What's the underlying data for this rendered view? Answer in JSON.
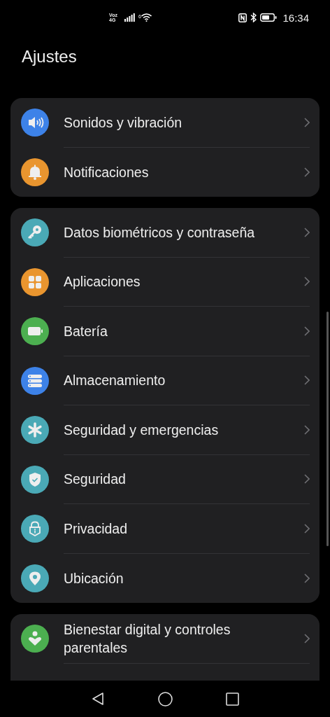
{
  "status_bar": {
    "network_top": "Voz",
    "network_bottom": "4G",
    "wifi_badge": "6",
    "time": "16:34"
  },
  "title": "Ajustes",
  "groups": [
    {
      "items": [
        {
          "label": "Sonidos y vibración",
          "kind": "speaker",
          "color": "#3d82e8"
        },
        {
          "label": "Notificaciones",
          "kind": "bell",
          "color": "#e9952f"
        }
      ]
    },
    {
      "items": [
        {
          "label": "Datos biométricos y contraseña",
          "kind": "key",
          "color": "#4aa9b6"
        },
        {
          "label": "Aplicaciones",
          "kind": "grid",
          "color": "#e9952f"
        },
        {
          "label": "Batería",
          "kind": "battery",
          "color": "#4caf50"
        },
        {
          "label": "Almacenamiento",
          "kind": "storage",
          "color": "#3d82e8"
        },
        {
          "label": "Seguridad y emergencias",
          "kind": "asterisk",
          "color": "#4aa9b6"
        },
        {
          "label": "Seguridad",
          "kind": "shield",
          "color": "#4aa9b6"
        },
        {
          "label": "Privacidad",
          "kind": "lock",
          "color": "#4aa9b6"
        },
        {
          "label": "Ubicación",
          "kind": "pin",
          "color": "#4aa9b6"
        }
      ]
    },
    {
      "items": [
        {
          "label": "Bienestar digital y controles parentales",
          "kind": "heart",
          "color": "#4caf50"
        }
      ]
    }
  ]
}
